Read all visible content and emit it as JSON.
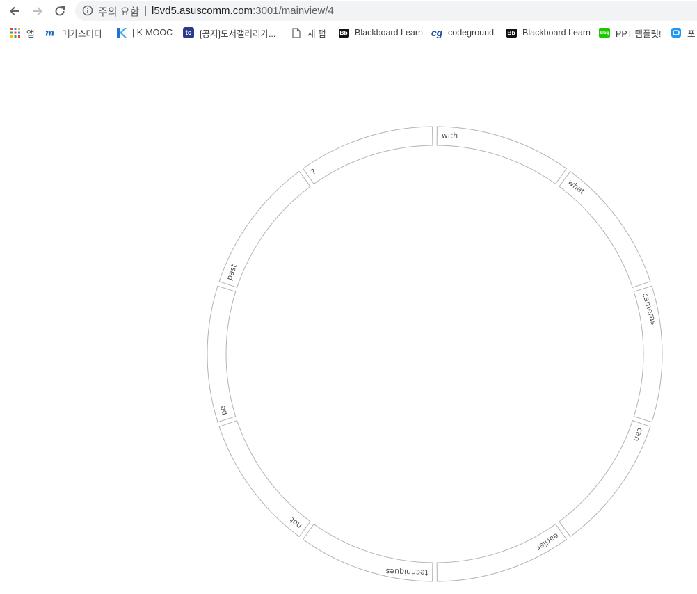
{
  "browser": {
    "omnibox": {
      "security_label": "주의 요함",
      "url_host": "l5vd5.asuscomm.com",
      "url_path": ":3001/mainview/4"
    },
    "bookmarks": [
      {
        "label": "앱",
        "icon": "apps-grid-icon"
      },
      {
        "label": "메가스터디",
        "icon": "megastudy-icon"
      },
      {
        "label": "| K-MOOC",
        "icon": "kmooc-icon"
      },
      {
        "label": "[공지]도서갤러리가...",
        "icon": "tc-icon"
      },
      {
        "label": "새 탭",
        "icon": "page-icon"
      },
      {
        "label": "Blackboard Learn",
        "icon": "bb-icon"
      },
      {
        "label": "codeground",
        "icon": "cg-icon"
      },
      {
        "label": "Blackboard Learn",
        "icon": "bb-icon"
      },
      {
        "label": "PPT 템플릿!",
        "icon": "blog-icon"
      },
      {
        "label": "포",
        "icon": "bookmark-icon"
      }
    ]
  },
  "wheel": {
    "words": [
      "with",
      "what",
      "cameras",
      "can",
      "earlier",
      "techniques",
      "not",
      "be",
      "past",
      "?"
    ],
    "colors": {
      "stroke": "#b3b3b3",
      "text": "#555555"
    }
  }
}
